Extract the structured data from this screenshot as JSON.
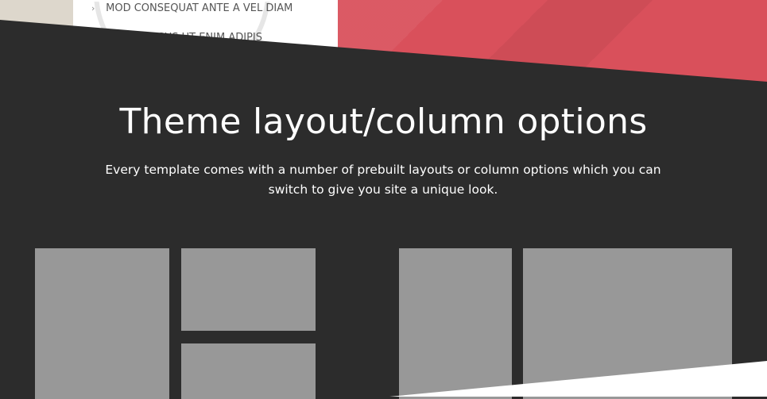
{
  "feature_card": {
    "items": [
      "MOD CONSEQUAT ANTE A VEL DIAM",
      "SED IN LACUS UT ENIM ADIPIS"
    ]
  },
  "section": {
    "title": "Theme layout/column options",
    "description": "Every template comes with a number of prebuilt layouts or column options which you can switch to give you site a unique look."
  },
  "colors": {
    "dark_bg": "#2c2c2c",
    "accent_red": "#d9505b",
    "placeholder_gray": "#989898"
  }
}
